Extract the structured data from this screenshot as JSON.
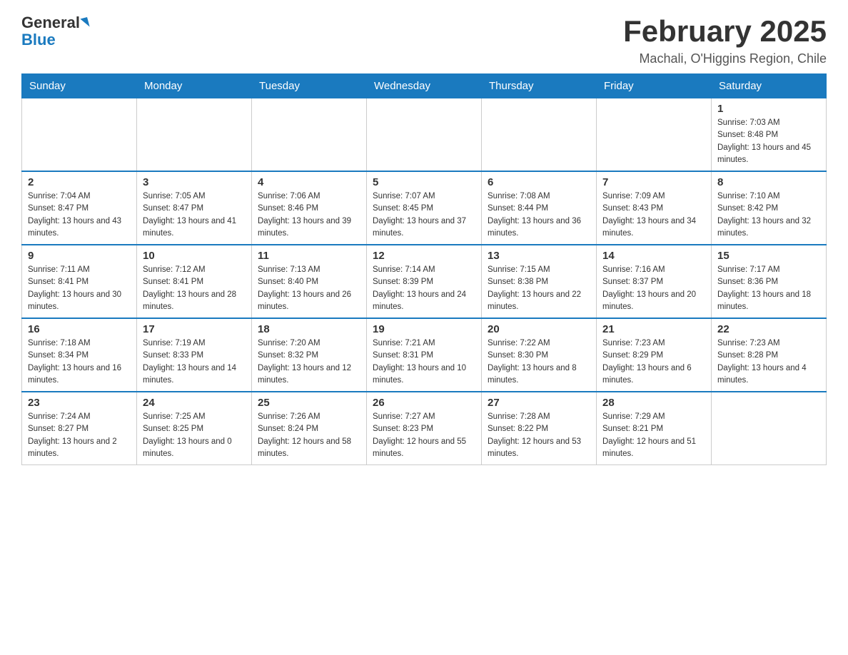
{
  "header": {
    "logo_general": "General",
    "logo_blue": "Blue",
    "month_title": "February 2025",
    "location": "Machali, O'Higgins Region, Chile"
  },
  "weekdays": [
    "Sunday",
    "Monday",
    "Tuesday",
    "Wednesday",
    "Thursday",
    "Friday",
    "Saturday"
  ],
  "weeks": [
    [
      {
        "day": "",
        "info": ""
      },
      {
        "day": "",
        "info": ""
      },
      {
        "day": "",
        "info": ""
      },
      {
        "day": "",
        "info": ""
      },
      {
        "day": "",
        "info": ""
      },
      {
        "day": "",
        "info": ""
      },
      {
        "day": "1",
        "info": "Sunrise: 7:03 AM\nSunset: 8:48 PM\nDaylight: 13 hours and 45 minutes."
      }
    ],
    [
      {
        "day": "2",
        "info": "Sunrise: 7:04 AM\nSunset: 8:47 PM\nDaylight: 13 hours and 43 minutes."
      },
      {
        "day": "3",
        "info": "Sunrise: 7:05 AM\nSunset: 8:47 PM\nDaylight: 13 hours and 41 minutes."
      },
      {
        "day": "4",
        "info": "Sunrise: 7:06 AM\nSunset: 8:46 PM\nDaylight: 13 hours and 39 minutes."
      },
      {
        "day": "5",
        "info": "Sunrise: 7:07 AM\nSunset: 8:45 PM\nDaylight: 13 hours and 37 minutes."
      },
      {
        "day": "6",
        "info": "Sunrise: 7:08 AM\nSunset: 8:44 PM\nDaylight: 13 hours and 36 minutes."
      },
      {
        "day": "7",
        "info": "Sunrise: 7:09 AM\nSunset: 8:43 PM\nDaylight: 13 hours and 34 minutes."
      },
      {
        "day": "8",
        "info": "Sunrise: 7:10 AM\nSunset: 8:42 PM\nDaylight: 13 hours and 32 minutes."
      }
    ],
    [
      {
        "day": "9",
        "info": "Sunrise: 7:11 AM\nSunset: 8:41 PM\nDaylight: 13 hours and 30 minutes."
      },
      {
        "day": "10",
        "info": "Sunrise: 7:12 AM\nSunset: 8:41 PM\nDaylight: 13 hours and 28 minutes."
      },
      {
        "day": "11",
        "info": "Sunrise: 7:13 AM\nSunset: 8:40 PM\nDaylight: 13 hours and 26 minutes."
      },
      {
        "day": "12",
        "info": "Sunrise: 7:14 AM\nSunset: 8:39 PM\nDaylight: 13 hours and 24 minutes."
      },
      {
        "day": "13",
        "info": "Sunrise: 7:15 AM\nSunset: 8:38 PM\nDaylight: 13 hours and 22 minutes."
      },
      {
        "day": "14",
        "info": "Sunrise: 7:16 AM\nSunset: 8:37 PM\nDaylight: 13 hours and 20 minutes."
      },
      {
        "day": "15",
        "info": "Sunrise: 7:17 AM\nSunset: 8:36 PM\nDaylight: 13 hours and 18 minutes."
      }
    ],
    [
      {
        "day": "16",
        "info": "Sunrise: 7:18 AM\nSunset: 8:34 PM\nDaylight: 13 hours and 16 minutes."
      },
      {
        "day": "17",
        "info": "Sunrise: 7:19 AM\nSunset: 8:33 PM\nDaylight: 13 hours and 14 minutes."
      },
      {
        "day": "18",
        "info": "Sunrise: 7:20 AM\nSunset: 8:32 PM\nDaylight: 13 hours and 12 minutes."
      },
      {
        "day": "19",
        "info": "Sunrise: 7:21 AM\nSunset: 8:31 PM\nDaylight: 13 hours and 10 minutes."
      },
      {
        "day": "20",
        "info": "Sunrise: 7:22 AM\nSunset: 8:30 PM\nDaylight: 13 hours and 8 minutes."
      },
      {
        "day": "21",
        "info": "Sunrise: 7:23 AM\nSunset: 8:29 PM\nDaylight: 13 hours and 6 minutes."
      },
      {
        "day": "22",
        "info": "Sunrise: 7:23 AM\nSunset: 8:28 PM\nDaylight: 13 hours and 4 minutes."
      }
    ],
    [
      {
        "day": "23",
        "info": "Sunrise: 7:24 AM\nSunset: 8:27 PM\nDaylight: 13 hours and 2 minutes."
      },
      {
        "day": "24",
        "info": "Sunrise: 7:25 AM\nSunset: 8:25 PM\nDaylight: 13 hours and 0 minutes."
      },
      {
        "day": "25",
        "info": "Sunrise: 7:26 AM\nSunset: 8:24 PM\nDaylight: 12 hours and 58 minutes."
      },
      {
        "day": "26",
        "info": "Sunrise: 7:27 AM\nSunset: 8:23 PM\nDaylight: 12 hours and 55 minutes."
      },
      {
        "day": "27",
        "info": "Sunrise: 7:28 AM\nSunset: 8:22 PM\nDaylight: 12 hours and 53 minutes."
      },
      {
        "day": "28",
        "info": "Sunrise: 7:29 AM\nSunset: 8:21 PM\nDaylight: 12 hours and 51 minutes."
      },
      {
        "day": "",
        "info": ""
      }
    ]
  ]
}
